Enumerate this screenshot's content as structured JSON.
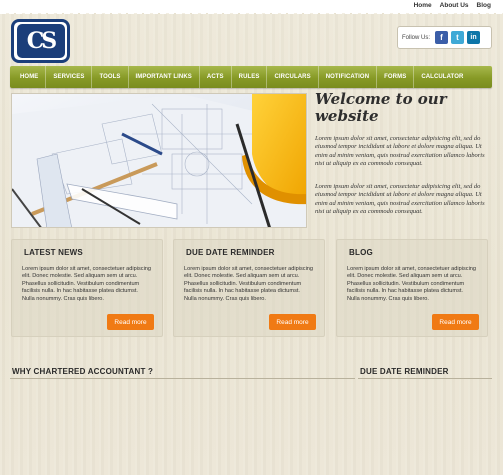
{
  "top_links": [
    "Home",
    "About Us",
    "Blog"
  ],
  "logo": {
    "text": "CS"
  },
  "follow": {
    "label": "Follow Us:",
    "icons": [
      {
        "name": "facebook-icon",
        "glyph": "f"
      },
      {
        "name": "twitter-icon",
        "glyph": "t"
      },
      {
        "name": "linkedin-icon",
        "glyph": "in"
      }
    ]
  },
  "nav": [
    "HOME",
    "SERVICES",
    "TOOLS",
    "IMPORTANT LINKS",
    "ACTS",
    "RULES",
    "CIRCULARS",
    "NOTIFICATION",
    "FORMS",
    "CALCULATOR"
  ],
  "welcome": {
    "title": "Welcome to our website",
    "paragraphs": [
      "Lorem ipsum dolor sit amet, consectetur adipisicing elit, sed do eiusmod tempor incididunt ut labore et dolore magna aliqua. Ut enim ad minim veniam, quis nostrud exercitation ullamco laboris nisi ut aliquip ex ea commodo consequat.",
      "Lorem ipsum dolor sit amet, consectetur adipisicing elit, sed do eiusmod tempor incididunt ut labore et dolore magna aliqua. Ut enim ad minim veniam, quis nostrud exercitation ullamco laboris nisi ut aliquip ex ea commodo consequat."
    ]
  },
  "boxes": [
    {
      "title": "LATEST NEWS",
      "text": "Lorem ipsum dolor sit amet, consectetuer adipiscing elit. Donec molestie. Sed aliquam sem ut arcu. Phasellus sollicitudin. Vestibulum condimentum facilisis nulla. In hac habitasse platea dictumst. Nulla nonummy. Cras quis libero.",
      "button": "Read more"
    },
    {
      "title": "DUE DATE REMINDER",
      "text": "Lorem ipsum dolor sit amet, consectetuer adipiscing elit. Donec molestie. Sed aliquam sem ut arcu. Phasellus sollicitudin. Vestibulum condimentum facilisis nulla. In hac habitasse platea dictumst. Nulla nonummy. Cras quis libero.",
      "button": "Read more"
    },
    {
      "title": "BLOG",
      "text": "Lorem ipsum dolor sit amet, consectetuer adipiscing elit. Donec molestie. Sed aliquam sem ut arcu. Phasellus sollicitudin. Vestibulum condimentum facilisis nulla. In hac habitasse platea dictumst. Nulla nonummy. Cras quis libero.",
      "button": "Read more"
    }
  ],
  "bottom": {
    "left_heading": "WHY CHARTERED ACCOUNTANT ?",
    "right_heading": "DUE DATE REMINDER"
  },
  "colors": {
    "nav_green": "#879a26",
    "logo_blue": "#1b3e7a",
    "button_orange": "#f07a14",
    "background": "#ede7d6"
  }
}
